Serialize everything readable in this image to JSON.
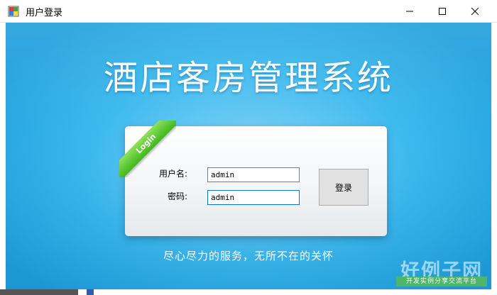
{
  "window": {
    "title": "用户登录",
    "minimize_glyph": "—",
    "maximize_glyph": "☐",
    "close_glyph": "✕"
  },
  "app": {
    "title": "酒店客房管理系统",
    "ribbon": "Login",
    "slogan": "尽心尽力的服务，无所不在的关怀"
  },
  "form": {
    "username_label": "用户名:",
    "password_label": "密码:",
    "username_value": "admin",
    "password_value": "admin",
    "login_button": "登录"
  },
  "watermark": {
    "main": "好例子网",
    "sub": "开发实例分享交流平台"
  },
  "colors": {
    "background": "#3cb9ee",
    "ribbon": "#3fb71d"
  }
}
